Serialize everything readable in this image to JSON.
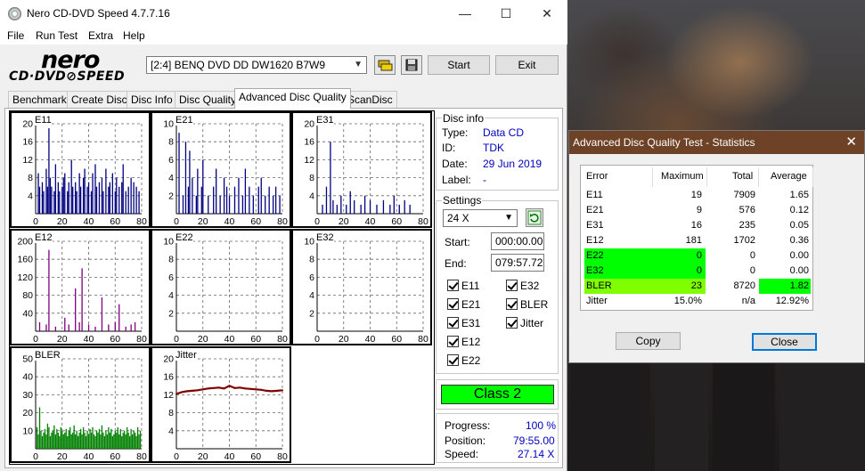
{
  "window": {
    "title": "Nero CD-DVD Speed 4.7.7.16"
  },
  "menu": [
    "File",
    "Run Test",
    "Extra",
    "Help"
  ],
  "logo": {
    "line1": "nero",
    "line2": "CD·DVD⊘SPEED"
  },
  "drive": {
    "selected": "[2:4]   BENQ DVD DD DW1620 B7W9"
  },
  "buttons": {
    "start": "Start",
    "exit": "Exit"
  },
  "tabs": [
    "Benchmark",
    "Create Disc",
    "Disc Info",
    "Disc Quality",
    "Advanced Disc Quality",
    "ScanDisc"
  ],
  "active_tab": "Advanced Disc Quality",
  "disc_info": {
    "label": "Disc info",
    "type_label": "Type:",
    "type": "Data CD",
    "id_label": "ID:",
    "id": "TDK",
    "date_label": "Date:",
    "date": "29 Jun 2019",
    "disc_label_label": "Label:",
    "disc_label": "-"
  },
  "settings": {
    "label": "Settings",
    "speed": "24 X",
    "start_label": "Start:",
    "start": "000:00.00",
    "end_label": "End:",
    "end": "079:57.72",
    "checks": [
      "E11",
      "E32",
      "E21",
      "BLER",
      "E31",
      "Jitter",
      "E12",
      "E22"
    ]
  },
  "class": "Class 2",
  "progress": {
    "progress_label": "Progress:",
    "progress": "100 %",
    "position_label": "Position:",
    "position": "79:55.00",
    "speed_label": "Speed:",
    "speed": "27.14 X"
  },
  "chart_data": [
    {
      "type": "bar",
      "title": "E11",
      "xlim": [
        0,
        80
      ],
      "ylim": [
        0,
        20
      ],
      "yticks": [
        4,
        8,
        12,
        16,
        20
      ],
      "xticks": [
        0,
        20,
        40,
        60,
        80
      ],
      "color": "#000080",
      "x": [
        2,
        3,
        5,
        6,
        8,
        9,
        10,
        11,
        12,
        14,
        15,
        17,
        18,
        20,
        21,
        22,
        24,
        25,
        27,
        28,
        30,
        31,
        33,
        34,
        36,
        37,
        39,
        40,
        42,
        43,
        45,
        46,
        48,
        50,
        51,
        53,
        55,
        56,
        58,
        60,
        61,
        63,
        65,
        66,
        68,
        70,
        72,
        74,
        76,
        78
      ],
      "values": [
        9,
        6,
        7,
        5,
        10,
        6,
        19,
        8,
        6,
        5,
        11,
        7,
        5,
        6,
        8,
        9,
        5,
        7,
        12,
        6,
        7,
        5,
        9,
        6,
        8,
        10,
        6,
        7,
        5,
        9,
        11,
        6,
        7,
        8,
        5,
        10,
        6,
        7,
        9,
        5,
        8,
        6,
        7,
        11,
        5,
        6,
        8,
        7,
        6,
        5
      ]
    },
    {
      "type": "bar",
      "title": "E21",
      "xlim": [
        0,
        80
      ],
      "ylim": [
        0,
        10
      ],
      "yticks": [
        2,
        4,
        6,
        8,
        10
      ],
      "xticks": [
        0,
        20,
        40,
        60,
        80
      ],
      "color": "#000080",
      "x": [
        2,
        5,
        7,
        9,
        10,
        12,
        15,
        16,
        19,
        20,
        24,
        28,
        30,
        33,
        36,
        38,
        40,
        44,
        47,
        50,
        52,
        55,
        58,
        62,
        64,
        67,
        70,
        73,
        75,
        78
      ],
      "values": [
        9,
        2,
        8,
        3,
        7,
        4,
        2,
        5,
        3,
        6,
        2,
        3,
        5,
        2,
        4,
        3,
        2,
        3,
        4,
        2,
        5,
        3,
        2,
        3,
        4,
        2,
        3,
        2,
        3,
        2
      ]
    },
    {
      "type": "bar",
      "title": "E31",
      "xlim": [
        0,
        80
      ],
      "ylim": [
        0,
        20
      ],
      "yticks": [
        4,
        8,
        12,
        16,
        20
      ],
      "xticks": [
        0,
        20,
        40,
        60,
        80
      ],
      "color": "#000080",
      "x": [
        4,
        7,
        10,
        12,
        15,
        18,
        22,
        25,
        28,
        33,
        36,
        40,
        45,
        50,
        55,
        58,
        62,
        66,
        70
      ],
      "values": [
        2,
        6,
        16,
        3,
        2,
        4,
        2,
        5,
        3,
        2,
        4,
        3,
        2,
        3,
        2,
        4,
        2,
        3,
        2
      ]
    },
    {
      "type": "bar",
      "title": "E12",
      "xlim": [
        0,
        80
      ],
      "ylim": [
        0,
        200
      ],
      "yticks": [
        40,
        80,
        120,
        160,
        200
      ],
      "xticks": [
        0,
        20,
        40,
        60,
        80
      ],
      "color": "#800080",
      "x": [
        3,
        8,
        10,
        15,
        22,
        25,
        30,
        33,
        35,
        40,
        45,
        50,
        55,
        60,
        63,
        68,
        72,
        75
      ],
      "values": [
        20,
        15,
        181,
        10,
        30,
        15,
        95,
        20,
        140,
        15,
        10,
        75,
        15,
        20,
        60,
        10,
        15,
        20
      ]
    },
    {
      "type": "bar",
      "title": "E22",
      "xlim": [
        0,
        80
      ],
      "ylim": [
        0,
        10
      ],
      "yticks": [
        2,
        4,
        6,
        8,
        10
      ],
      "xticks": [
        0,
        20,
        40,
        60,
        80
      ],
      "color": "#000080",
      "x": [],
      "values": []
    },
    {
      "type": "bar",
      "title": "E32",
      "xlim": [
        0,
        80
      ],
      "ylim": [
        0,
        10
      ],
      "yticks": [
        2,
        4,
        6,
        8,
        10
      ],
      "xticks": [
        0,
        20,
        40,
        60,
        80
      ],
      "color": "#000080",
      "x": [],
      "values": []
    },
    {
      "type": "bar",
      "title": "BLER",
      "xlim": [
        0,
        80
      ],
      "ylim": [
        0,
        50
      ],
      "yticks": [
        10,
        20,
        30,
        40,
        50
      ],
      "xticks": [
        0,
        20,
        40,
        60,
        80
      ],
      "color": "#008000",
      "x": [
        1,
        2,
        3,
        4,
        5,
        6,
        7,
        8,
        9,
        10,
        11,
        12,
        13,
        14,
        15,
        16,
        17,
        18,
        19,
        20,
        21,
        22,
        23,
        24,
        25,
        26,
        27,
        28,
        29,
        30,
        31,
        32,
        33,
        34,
        35,
        36,
        37,
        38,
        39,
        40,
        41,
        42,
        43,
        44,
        45,
        46,
        47,
        48,
        49,
        50,
        51,
        52,
        53,
        54,
        55,
        56,
        57,
        58,
        59,
        60,
        61,
        62,
        63,
        64,
        65,
        66,
        67,
        68,
        69,
        70,
        71,
        72,
        73,
        74,
        75,
        76,
        77,
        78,
        79
      ],
      "values": [
        12,
        8,
        23,
        10,
        7,
        9,
        11,
        8,
        14,
        12,
        7,
        9,
        10,
        13,
        8,
        11,
        9,
        7,
        12,
        10,
        8,
        9,
        11,
        7,
        10,
        12,
        8,
        9,
        13,
        8,
        10,
        7,
        9,
        11,
        8,
        12,
        9,
        7,
        10,
        8,
        11,
        9,
        12,
        8,
        7,
        10,
        9,
        11,
        8,
        13,
        9,
        7,
        10,
        8,
        12,
        9,
        11,
        7,
        8,
        10,
        9,
        12,
        8,
        11,
        7,
        9,
        10,
        8,
        12,
        9,
        7,
        11,
        8,
        10,
        9,
        7,
        12,
        8,
        10
      ]
    },
    {
      "type": "line",
      "title": "Jitter",
      "xlim": [
        0,
        80
      ],
      "ylim": [
        0,
        20
      ],
      "yticks": [
        4,
        8,
        12,
        16,
        20
      ],
      "xticks": [
        0,
        20,
        40,
        60,
        80
      ],
      "color": "#800000",
      "x": [
        0,
        4,
        8,
        12,
        16,
        20,
        24,
        28,
        32,
        36,
        40,
        44,
        48,
        52,
        56,
        60,
        64,
        68,
        72,
        76,
        80
      ],
      "values": [
        12.2,
        12.6,
        12.8,
        12.9,
        13.0,
        13.2,
        13.4,
        13.5,
        13.6,
        13.4,
        14.0,
        13.5,
        13.6,
        13.4,
        13.3,
        13.2,
        13.1,
        12.9,
        12.8,
        12.9,
        13.0
      ]
    }
  ],
  "stats_dialog": {
    "title": "Advanced Disc Quality Test - Statistics",
    "headers": [
      "Error",
      "Maximum",
      "Total",
      "Average"
    ],
    "rows": [
      {
        "name": "E11",
        "max": "19",
        "total": "7909",
        "avg": "1.65",
        "highlight": ""
      },
      {
        "name": "E21",
        "max": "9",
        "total": "576",
        "avg": "0.12",
        "highlight": ""
      },
      {
        "name": "E31",
        "max": "16",
        "total": "235",
        "avg": "0.05",
        "highlight": ""
      },
      {
        "name": "E12",
        "max": "181",
        "total": "1702",
        "avg": "0.36",
        "highlight": ""
      },
      {
        "name": "E22",
        "max": "0",
        "total": "0",
        "avg": "0.00",
        "highlight": "#00ff00"
      },
      {
        "name": "E32",
        "max": "0",
        "total": "0",
        "avg": "0.00",
        "highlight": "#00ff00"
      },
      {
        "name": "BLER",
        "max": "23",
        "total": "8720",
        "avg": "1.82",
        "highlight": "#80ff00"
      },
      {
        "name": "Jitter",
        "max": "15.0%",
        "total": "n/a",
        "avg": "12.92%",
        "highlight": ""
      }
    ],
    "copy": "Copy",
    "close": "Close"
  },
  "colors": {
    "dialog_title": "#6e4226",
    "class_ok": "#00ff00"
  }
}
